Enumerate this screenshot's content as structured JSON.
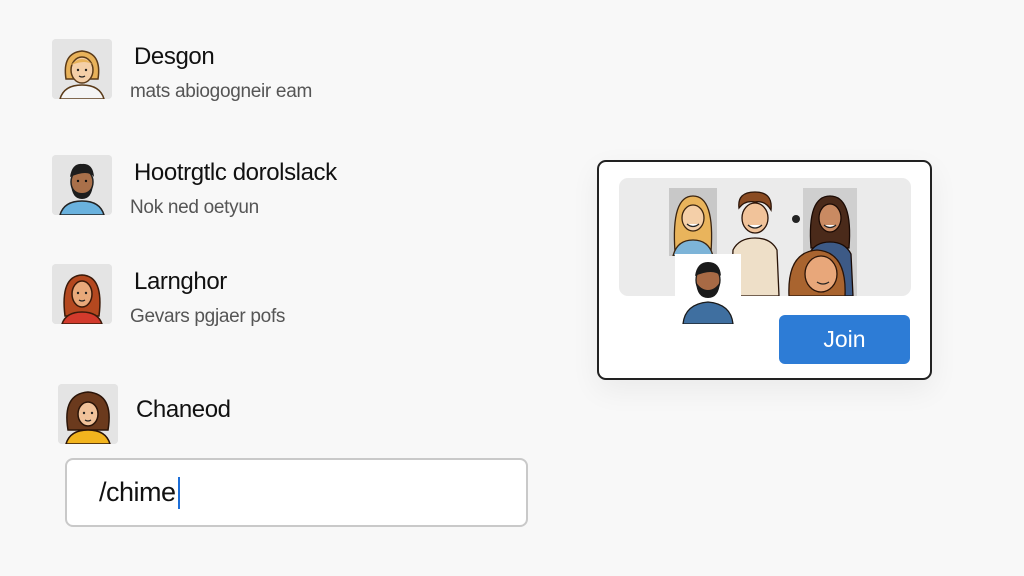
{
  "messages": [
    {
      "name": "Desgon",
      "text": "mats abiogogneir eam",
      "avatar": "woman-blonde-avatar"
    },
    {
      "name": "Hootrgtlc dorolslack",
      "text": "Nok ned oetyun",
      "avatar": "man-beard-avatar"
    },
    {
      "name": "Larnghor",
      "text": "Gevars pgjaer pofs",
      "avatar": "woman-red-hair-avatar"
    },
    {
      "name": "Chaneod",
      "text": "",
      "avatar": "woman-curly-hair-avatar"
    }
  ],
  "composer": {
    "value": "/chime"
  },
  "call_card": {
    "join_label": "Join",
    "participants": [
      "blonde-woman",
      "curly-haired-man",
      "dark-haired-woman",
      "bearded-man",
      "woman-waving"
    ]
  },
  "colors": {
    "accent": "#2d7cd6",
    "background": "#f8f8f8",
    "border": "#222222"
  }
}
